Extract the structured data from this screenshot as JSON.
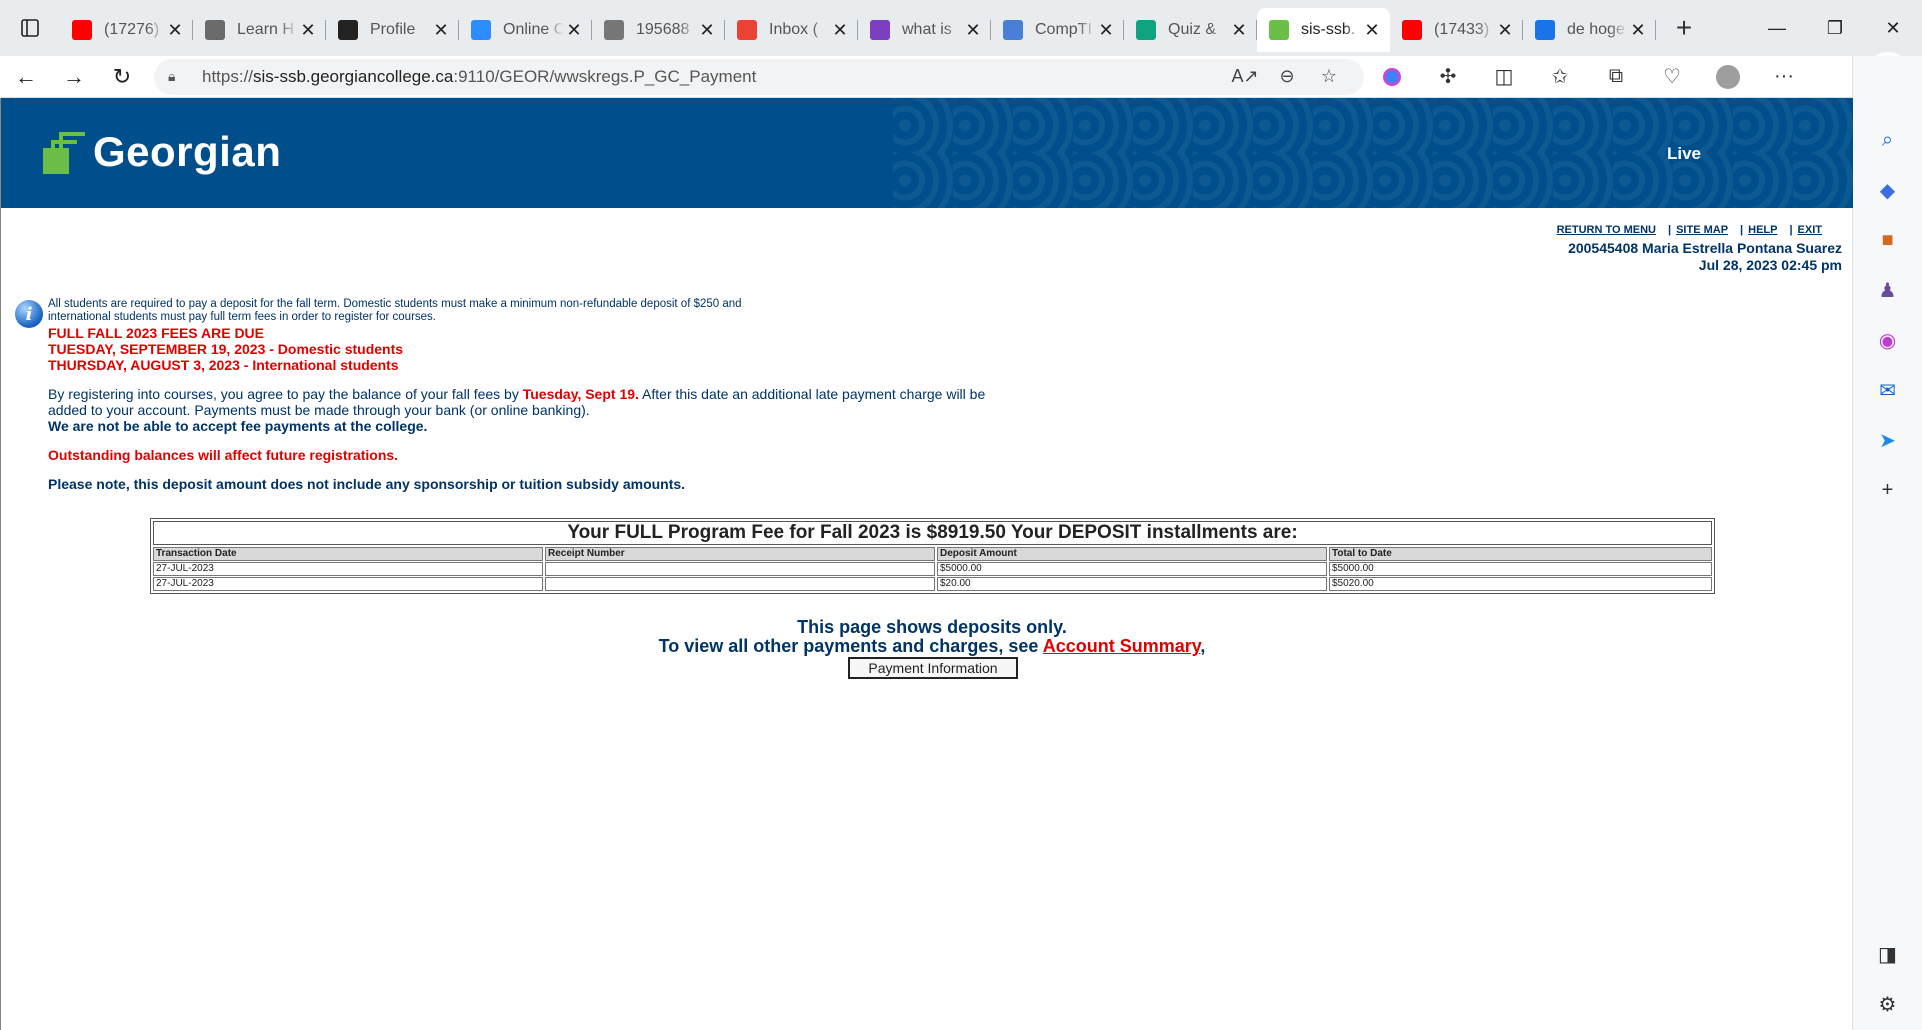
{
  "browser": {
    "tabs": [
      {
        "title": "(17276)",
        "icon": "youtube-icon",
        "color": "#ff0000"
      },
      {
        "title": "Learn H",
        "icon": "learn-icon",
        "color": "#6b6b6b"
      },
      {
        "title": "Profile",
        "icon": "profile-chart-icon",
        "color": "#222222"
      },
      {
        "title": "Online C",
        "icon": "zoom-icon",
        "color": "#2d8cff"
      },
      {
        "title": "195688",
        "icon": "blackboard-icon",
        "color": "#777777"
      },
      {
        "title": "Inbox (",
        "icon": "gmail-icon",
        "color": "#ea4335"
      },
      {
        "title": "what is",
        "icon": "yahoo-icon",
        "color": "#7b3fbf"
      },
      {
        "title": "CompTI",
        "icon": "comptia-icon",
        "color": "#4a7fd8"
      },
      {
        "title": "Quiz &",
        "icon": "chatgpt-icon",
        "color": "#10a37f"
      },
      {
        "title": "sis-ssb.",
        "icon": "georgian-icon",
        "color": "#6bbf46",
        "active": true
      },
      {
        "title": "(17433)",
        "icon": "youtube-icon",
        "color": "#ff0000"
      },
      {
        "title": "de hoge",
        "icon": "search-icon",
        "color": "#1a73e8"
      }
    ],
    "url_prefix": "https://",
    "url_host": "sis-ssb.georgiancollege.ca",
    "url_path": ":9110/GEOR/wwskregs.P_GC_Payment"
  },
  "header": {
    "logo_text": "Georgian",
    "environment_label": "Live"
  },
  "top_links": {
    "return_to_menu": "RETURN TO MENU",
    "site_map": "SITE MAP",
    "help": "HELP",
    "exit": "EXIT"
  },
  "user": {
    "id_name": "200545408 Maria Estrella Pontana Suarez",
    "datetime": "Jul 28, 2023 02:45 pm"
  },
  "notice": {
    "text": "All students are required to pay a deposit for the fall term. Domestic students must make a minimum non-refundable deposit of $250 and international students must pay full term fees in order to register for courses.",
    "due_heading": "FULL FALL 2023 FEES ARE DUE",
    "domestic_due": "TUESDAY, SEPTEMBER 19, 2023 - Domestic students",
    "international_due": "THURSDAY, AUGUST 3, 2023 - International students",
    "agree_part1": "By registering into courses, you agree to pay the balance of your fall fees by ",
    "agree_date": "Tuesday, Sept 19.",
    "agree_part2": " After this date an additional late payment charge will be added to your account. Payments must be made through your bank (or online banking).",
    "no_college_payments": "We are not be able to accept fee payments at the college.",
    "outstanding": "Outstanding balances will affect future registrations.",
    "sponsorship_note": "Please note, this deposit amount does not include any sponsorship or tuition subsidy amounts."
  },
  "fee_table": {
    "caption": "Your FULL Program Fee for Fall 2023 is $8919.50 Your DEPOSIT installments are:",
    "headers": [
      "Transaction Date",
      "Receipt Number",
      "Deposit Amount",
      "Total to Date"
    ],
    "rows": [
      [
        "27-JUL-2023",
        "",
        "$5000.00",
        "$5000.00"
      ],
      [
        "27-JUL-2023",
        "",
        "$20.00",
        "$5020.00"
      ]
    ]
  },
  "footer": {
    "deposits_only": "This page shows deposits only.",
    "view_other_prefix": "To view all other payments and charges, see ",
    "account_summary_link": "Account Summary",
    "view_other_suffix": ",",
    "payment_info_button": "Payment Information"
  }
}
